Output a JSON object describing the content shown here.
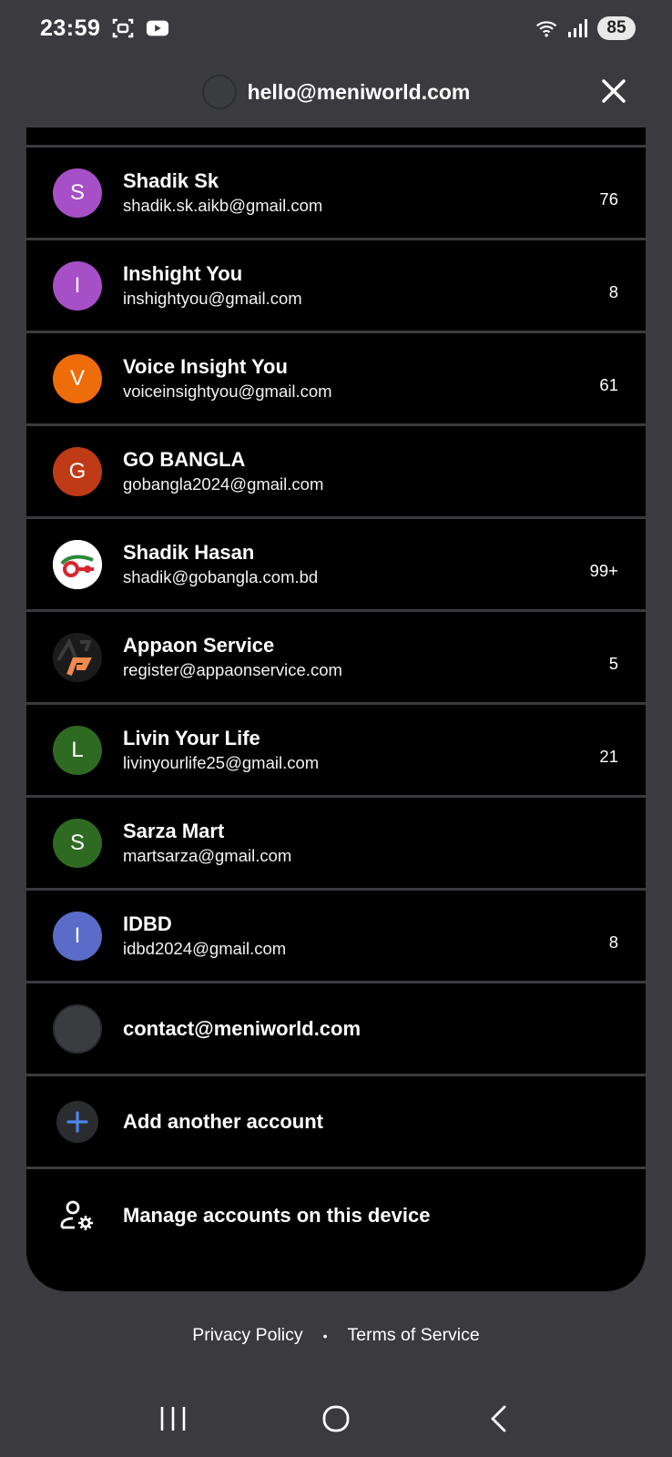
{
  "status_bar": {
    "time": "23:59",
    "battery": "85"
  },
  "header": {
    "email": "hello@meniworld.com"
  },
  "accounts": [
    {
      "name": "Shadik Sk",
      "email": "shadik.sk.aikb@gmail.com",
      "count": "76",
      "initial": "S",
      "color": "#a64fc6"
    },
    {
      "name": "Inshight You",
      "email": "inshightyou@gmail.com",
      "count": "8",
      "initial": "I",
      "color": "#a64fc6"
    },
    {
      "name": "Voice Insight You",
      "email": "voiceinsightyou@gmail.com",
      "count": "61",
      "initial": "V",
      "color": "#ef6c0b"
    },
    {
      "name": "GO BANGLA",
      "email": "gobangla2024@gmail.com",
      "count": "",
      "initial": "G",
      "color": "#bf3a16"
    },
    {
      "name": "Shadik Hasan",
      "email": "shadik@gobangla.com.bd",
      "count": "99+",
      "initial": "",
      "color": "#ffffff"
    },
    {
      "name": "Appaon Service",
      "email": "register@appaonservice.com",
      "count": "5",
      "initial": "",
      "color": "#1b1b1b"
    },
    {
      "name": "Livin Your Life",
      "email": "livinyourlife25@gmail.com",
      "count": "21",
      "initial": "L",
      "color": "#2f6a22"
    },
    {
      "name": "Sarza Mart",
      "email": "martsarza@gmail.com",
      "count": "",
      "initial": "S",
      "color": "#2f6a22"
    },
    {
      "name": "IDBD",
      "email": "idbd2024@gmail.com",
      "count": "8",
      "initial": "I",
      "color": "#5a6cc8"
    }
  ],
  "other_account": {
    "email": "contact@meniworld.com"
  },
  "actions": {
    "add_account": "Add another account",
    "manage_accounts": "Manage accounts on this device"
  },
  "footer": {
    "privacy": "Privacy Policy",
    "separator": "•",
    "terms": "Terms of Service"
  },
  "colors": {
    "background": "#3b3b3f",
    "card": "#000000",
    "accent_blue": "#4a86e8"
  }
}
